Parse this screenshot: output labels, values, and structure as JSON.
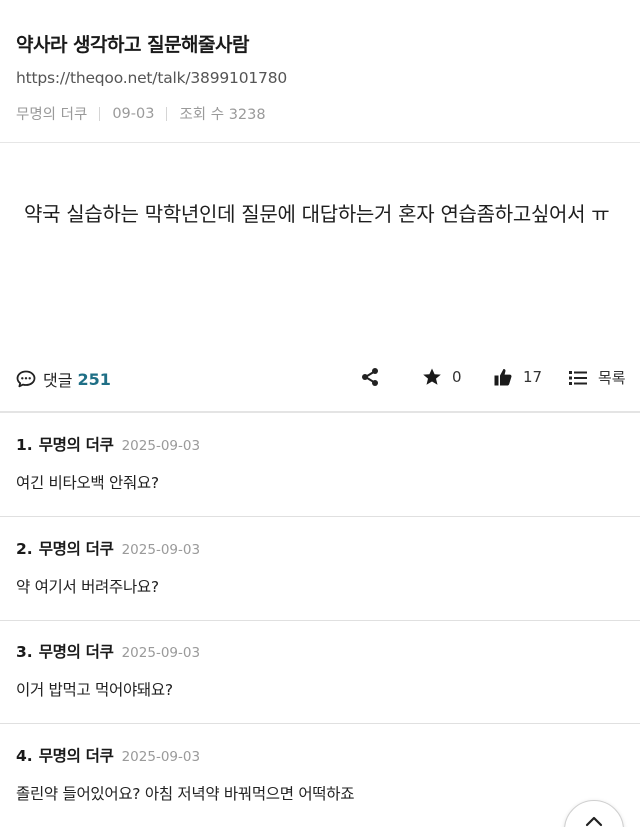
{
  "post": {
    "title": "약사라 생각하고 질문해줄사람",
    "url": "https://theqoo.net/talk/3899101780",
    "author": "무명의 더쿠",
    "date": "09-03",
    "views_label": "조회 수 3238",
    "content": "약국 실습하는 막학년인데 질문에 대답하는거 혼자 연습좀하고싶어서 ㅠ"
  },
  "actions": {
    "comment_label": "댓글",
    "comment_count": "251",
    "star_count": "0",
    "like_count": "17",
    "list_label": "목록"
  },
  "comments": [
    {
      "num": "1.",
      "author": "무명의 더쿠",
      "date": "2025-09-03",
      "text": "여긴 비타오백 안줘요?"
    },
    {
      "num": "2.",
      "author": "무명의 더쿠",
      "date": "2025-09-03",
      "text": "약 여기서 버려주나요?"
    },
    {
      "num": "3.",
      "author": "무명의 더쿠",
      "date": "2025-09-03",
      "text": "이거 밥먹고 먹어야돼요?"
    },
    {
      "num": "4.",
      "author": "무명의 더쿠",
      "date": "2025-09-03",
      "text": "졸린약 들어있어요? 아침 저녁약 바꿔먹으면 어떡하죠"
    }
  ],
  "colors": {
    "accent": "#1f6f86",
    "meta_gray": "#9a9a9a",
    "divider": "#e0e0e0"
  },
  "icons": [
    "comment-bubble-icon",
    "share-icon",
    "star-icon",
    "thumbs-up-icon",
    "list-icon",
    "arrow-up-icon"
  ]
}
